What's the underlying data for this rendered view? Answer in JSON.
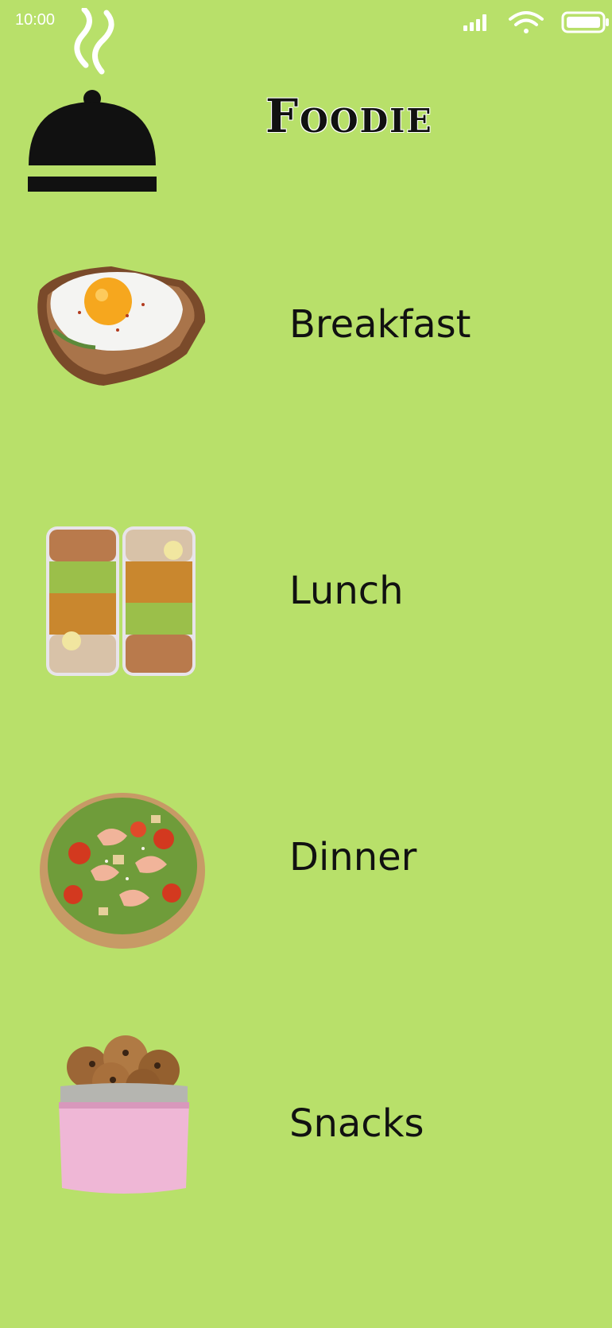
{
  "status_bar": {
    "time": "10:00",
    "icons": [
      "signal-icon",
      "wifi-icon",
      "battery-icon"
    ]
  },
  "app": {
    "title": "Foodie",
    "logo_icon": "serving-cloche-icon"
  },
  "menu": {
    "items": [
      {
        "label": "Breakfast",
        "icon": "egg-toast-image"
      },
      {
        "label": "Lunch",
        "icon": "lunch-boxes-image"
      },
      {
        "label": "Dinner",
        "icon": "salad-bowl-image"
      },
      {
        "label": "Snacks",
        "icon": "cookie-jar-image"
      }
    ]
  },
  "colors": {
    "background": "#b8e06a",
    "text": "#111111",
    "status_text": "#ffffff"
  }
}
